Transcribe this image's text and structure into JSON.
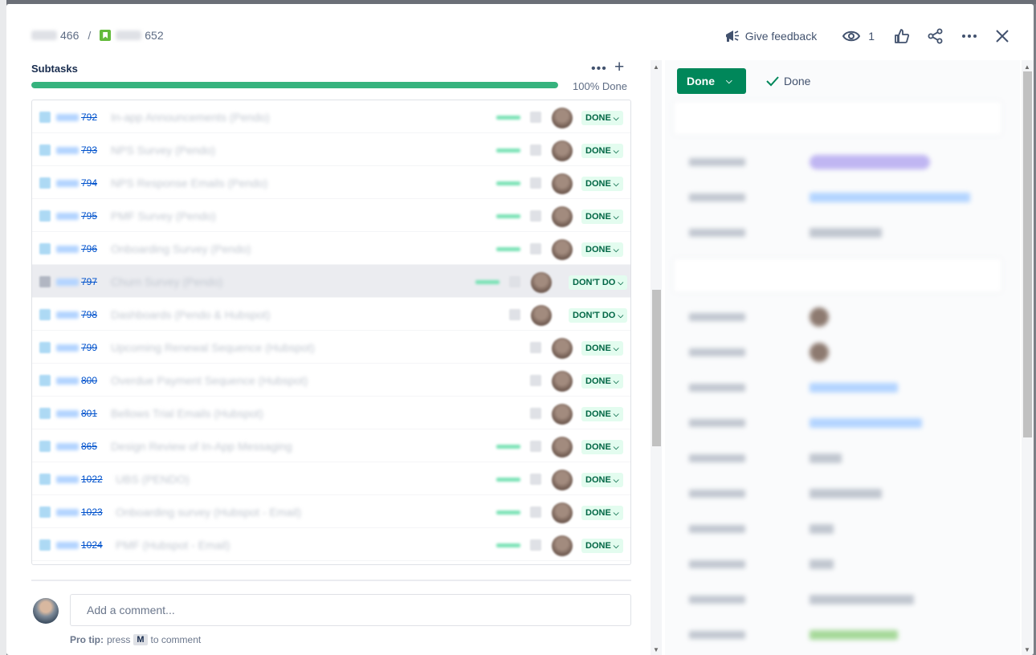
{
  "breadcrumb": {
    "parent_number": "466",
    "separator": "/",
    "current_number": "652"
  },
  "header": {
    "feedback_label": "Give feedback",
    "watch_count": "1",
    "icons": [
      "megaphone-icon",
      "eye-icon",
      "like-icon",
      "share-icon",
      "more-icon",
      "close-icon"
    ]
  },
  "subtasks": {
    "title": "Subtasks",
    "more_label": "•••",
    "add_label": "+",
    "progress_percent": 100,
    "progress_text": "100% Done",
    "items": [
      {
        "key": "792",
        "summary": "In-app Announcements (Pendo)",
        "status": "DONE"
      },
      {
        "key": "793",
        "summary": "NPS Survey (Pendo)",
        "status": "DONE"
      },
      {
        "key": "794",
        "summary": "NPS Response Emails (Pendo)",
        "status": "DONE"
      },
      {
        "key": "795",
        "summary": "PMF Survey (Pendo)",
        "status": "DONE"
      },
      {
        "key": "796",
        "summary": "Onboarding Survey (Pendo)",
        "status": "DONE"
      },
      {
        "key": "797",
        "summary": "Churn Survey (Pendo)",
        "status": "DON'T DO"
      },
      {
        "key": "798",
        "summary": "Dashboards (Pendo & Hubspot)",
        "status": "DON'T DO"
      },
      {
        "key": "799",
        "summary": "Upcoming Renewal Sequence (Hubspot)",
        "status": "DONE"
      },
      {
        "key": "800",
        "summary": "Overdue Payment Sequence (Hubspot)",
        "status": "DONE"
      },
      {
        "key": "801",
        "summary": "Bellows Trial Emails (Hubspot)",
        "status": "DONE"
      },
      {
        "key": "865",
        "summary": "Design Review of In-App Messaging",
        "status": "DONE"
      },
      {
        "key": "1022",
        "summary": "UBS (PENDO)",
        "status": "DONE"
      },
      {
        "key": "1023",
        "summary": "Onboarding survey (Hubspot - Email)",
        "status": "DONE"
      },
      {
        "key": "1024",
        "summary": "PMF (Hubspot - Email)",
        "status": "DONE"
      }
    ]
  },
  "comment": {
    "placeholder": "Add a comment...",
    "tip_bold": "Pro tip:",
    "tip_pre": "press",
    "tip_key": "M",
    "tip_post": "to comment"
  },
  "status_panel": {
    "button_label": "Done",
    "state_label": "Done"
  },
  "colors": {
    "done_green": "#00875a",
    "progress_green": "#36b37e",
    "link_blue": "#0052cc",
    "status_bg": "#e3fcef",
    "status_text": "#006644"
  }
}
